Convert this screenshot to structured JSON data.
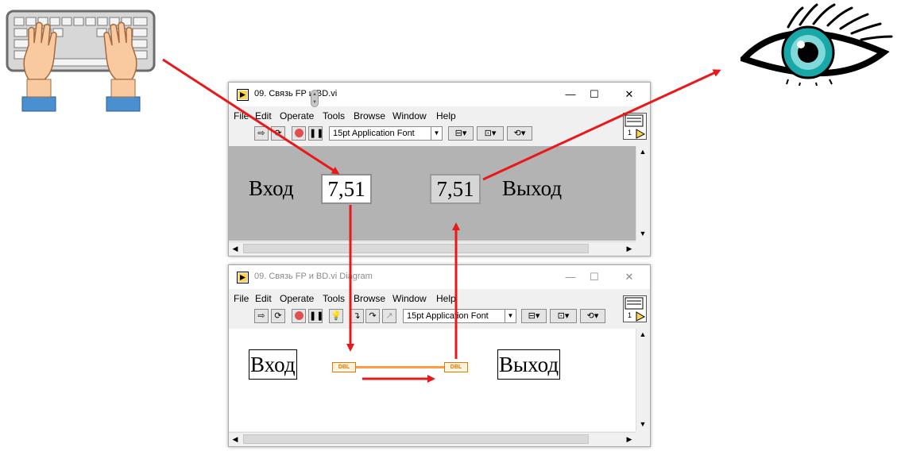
{
  "front_panel": {
    "title": "09. Связь FP и BD.vi",
    "menus": [
      "File",
      "Edit",
      "Operate",
      "Tools",
      "Browse",
      "Window",
      "Help"
    ],
    "font_select": "15pt Application Font",
    "input_label": "Вход",
    "input_value": "7,51",
    "output_value": "7,51",
    "output_label": "Выход"
  },
  "block_diagram": {
    "title": "09. Связь FP и BD.vi Diagram",
    "menus": [
      "File",
      "Edit",
      "Operate",
      "Tools",
      "Browse",
      "Window",
      "Help"
    ],
    "font_select": "15pt Application Font",
    "input_terminal_label": "Вход",
    "output_terminal_label": "Выход",
    "terminal_type": "DBL"
  },
  "window_controls": {
    "minimize": "—",
    "maximize": "☐",
    "close": "✕"
  },
  "icons": [
    "keyboard-hands-icon",
    "eye-icon",
    "run-arrow-icon",
    "run-continuous-icon",
    "abort-icon",
    "pause-icon",
    "highlight-bulb-icon",
    "step-icon",
    "align-icon",
    "distribute-icon",
    "reorder-icon",
    "vi-icon"
  ],
  "colors": {
    "arrow": "#e8191b",
    "panel_bg": "#b3b3b3",
    "wire": "#ff9a40",
    "terminal": "#e07a00"
  }
}
